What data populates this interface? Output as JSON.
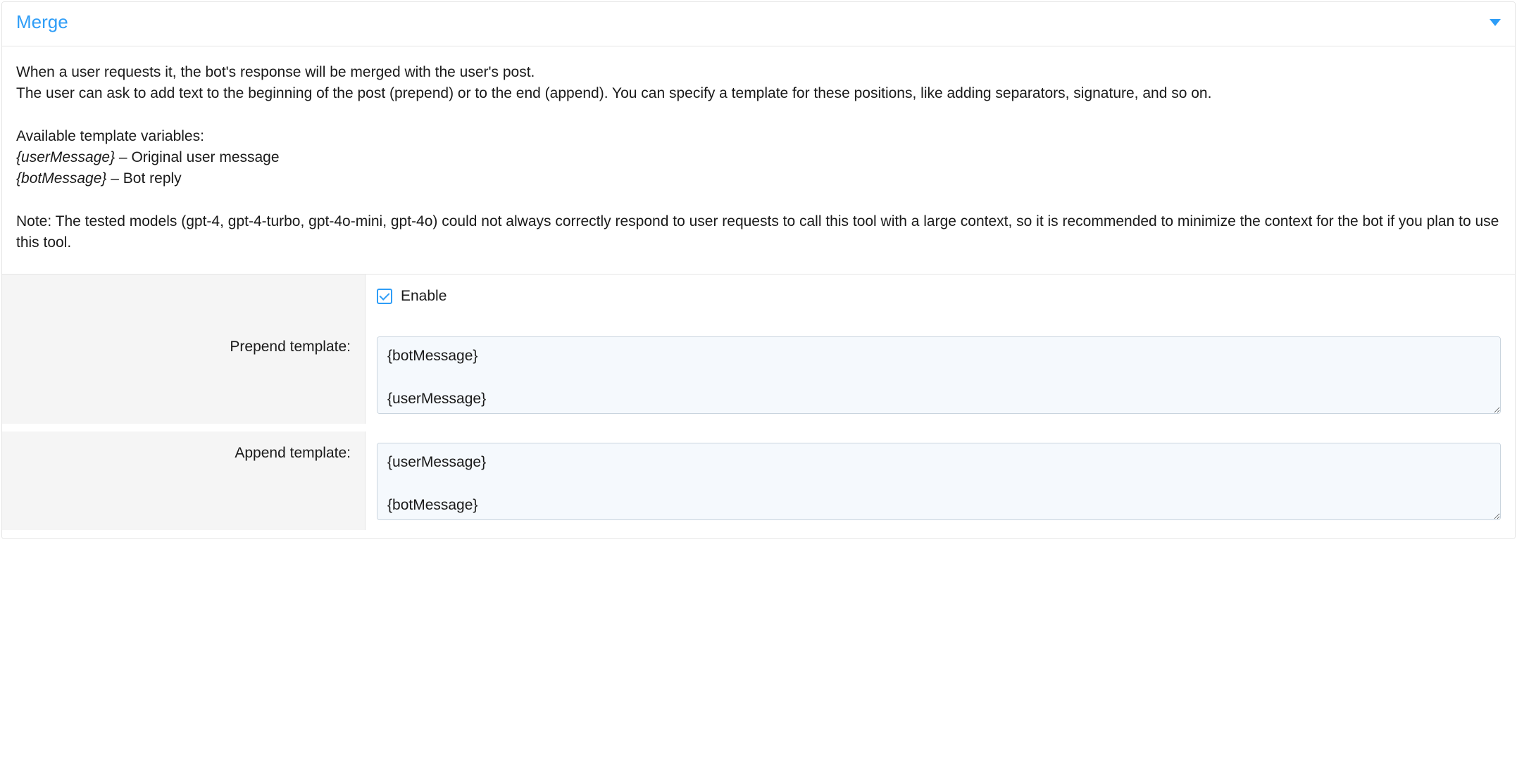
{
  "panel": {
    "title": "Merge",
    "description": {
      "line1": "When a user requests it, the bot's response will be merged with the user's post.",
      "line2": "The user can ask to add text to the beginning of the post (prepend) or to the end (append). You can specify a template for these positions, like adding separators, signature, and so on.",
      "vars_heading": "Available template variables:",
      "var1_name": "{userMessage}",
      "var1_desc": " – Original user message",
      "var2_name": "{botMessage}",
      "var2_desc": " – Bot reply",
      "note": "Note: The tested models (gpt-4, gpt-4-turbo, gpt-4o-mini, gpt-4o) could not always correctly respond to user requests to call this tool with a large context, so it is recommended to minimize the context for the bot if you plan to use this tool."
    }
  },
  "form": {
    "enable_label": "Enable",
    "enable_checked": true,
    "prepend": {
      "label": "Prepend template:",
      "value": "{botMessage}\n\n{userMessage}"
    },
    "append": {
      "label": "Append template:",
      "value": "{userMessage}\n\n{botMessage}"
    }
  }
}
